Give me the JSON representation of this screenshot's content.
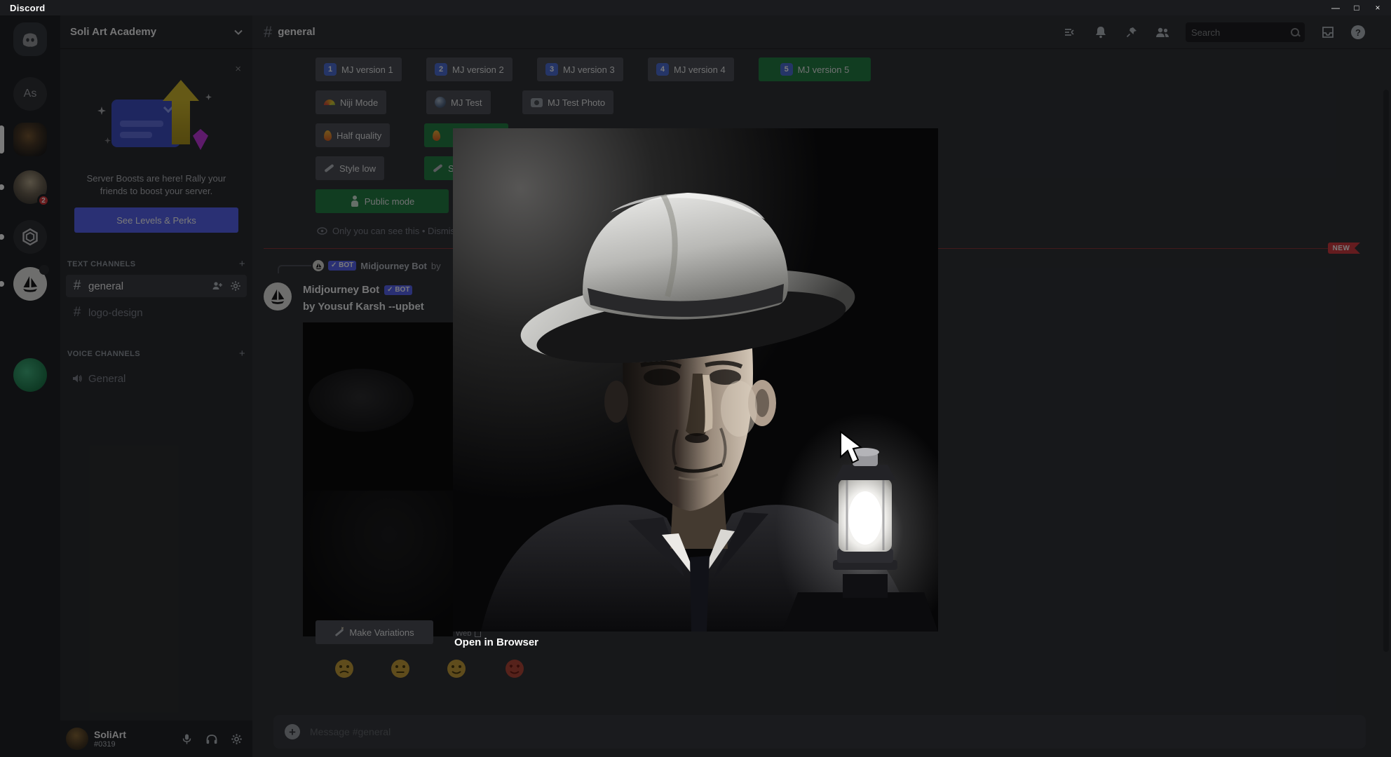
{
  "titlebar": {
    "app_name": "Discord",
    "minimize": "—",
    "maximize": "□",
    "close": "×"
  },
  "rail": {
    "as_initials": "As",
    "mention_badge": "2"
  },
  "sidebar": {
    "server_name": "Soli Art Academy",
    "boost": {
      "close": "×",
      "message": "Server Boosts are here! Rally your friends to boost your server.",
      "cta": "See Levels & Perks"
    },
    "text_channels_header": "TEXT CHANNELS",
    "voice_channels_header": "VOICE CHANNELS",
    "add": "+",
    "hash": "#",
    "channels": {
      "general": "general",
      "logo_design": "logo-design",
      "voice_general": "General"
    },
    "user": {
      "name": "SoliArt",
      "tag": "#0319"
    }
  },
  "header": {
    "hash": "#",
    "channel_name": "general",
    "search_placeholder": "Search",
    "help": "?"
  },
  "settings": {
    "versions": [
      {
        "num": "1",
        "label": "MJ version 1"
      },
      {
        "num": "2",
        "label": "MJ version 2"
      },
      {
        "num": "3",
        "label": "MJ version 3"
      },
      {
        "num": "4",
        "label": "MJ version 4"
      },
      {
        "num": "5",
        "label": "MJ version 5"
      }
    ],
    "niji": "Niji Mode",
    "mj_test": "MJ Test",
    "mj_test_photo": "MJ Test Photo",
    "half_quality": "Half quality",
    "style_low": "Style low",
    "style_partial": "St",
    "public_mode": "Public mode",
    "ephemeral": "Only you can see this • Dismiss message"
  },
  "chat": {
    "new_badge": "NEW",
    "reply_author": "Midjourney Bot",
    "reply_preview": "by",
    "bot_badge": "✓ BOT",
    "author": "Midjourney Bot",
    "content": "by Yousuf Karsh --upbet",
    "make_variations": "Make Variations",
    "web": "Web",
    "plus": "+",
    "input_placeholder": "Message #general"
  },
  "lightbox": {
    "open_in_browser": "Open in Browser"
  },
  "colors": {
    "blurple": "#5865f2",
    "green": "#248046",
    "danger": "#da373c"
  }
}
